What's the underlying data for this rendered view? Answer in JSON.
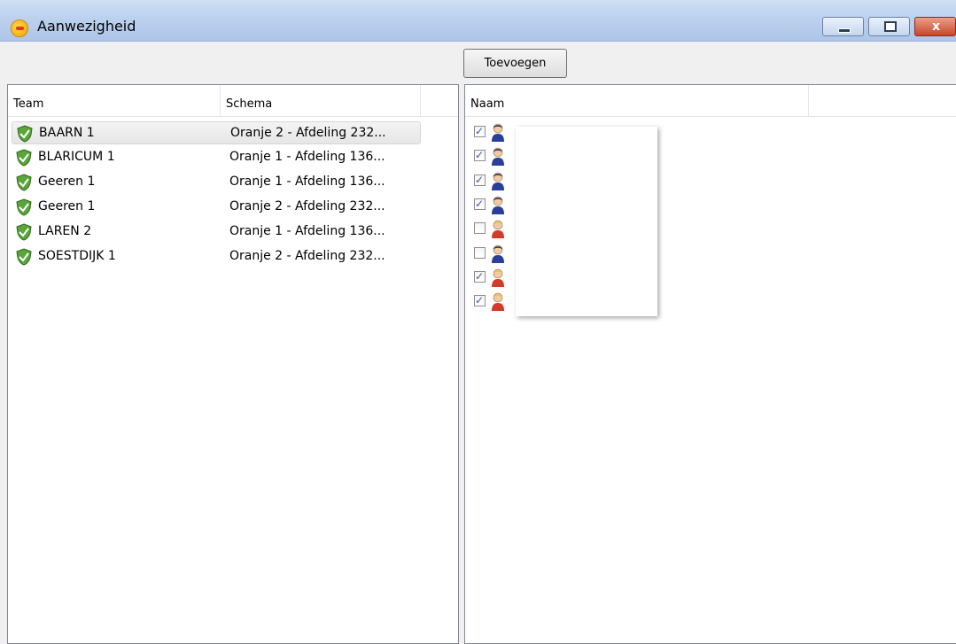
{
  "window": {
    "title": "Aanwezigheid",
    "close_glyph": "x"
  },
  "toolbar": {
    "add_label": "Toevoegen"
  },
  "teams_table": {
    "columns": [
      "Team",
      "Schema"
    ],
    "rows": [
      {
        "team": "BAARN 1",
        "schema": "Oranje 2 - Afdeling 232...",
        "selected": true
      },
      {
        "team": "BLARICUM 1",
        "schema": "Oranje 1 - Afdeling 136...",
        "selected": false
      },
      {
        "team": "Geeren 1",
        "schema": "Oranje 1 - Afdeling 136...",
        "selected": false
      },
      {
        "team": "Geeren 1",
        "schema": "Oranje 2 - Afdeling 232...",
        "selected": false
      },
      {
        "team": "LAREN 2",
        "schema": "Oranje 1 - Afdeling 136...",
        "selected": false
      },
      {
        "team": "SOESTDIJK 1",
        "schema": "Oranje 2 - Afdeling 232...",
        "selected": false
      }
    ]
  },
  "members_table": {
    "columns": [
      "Naam"
    ],
    "members": [
      {
        "checked": true,
        "icon": "male-person-icon"
      },
      {
        "checked": true,
        "icon": "male-person-icon"
      },
      {
        "checked": true,
        "icon": "male-person-icon"
      },
      {
        "checked": true,
        "icon": "male-person-icon"
      },
      {
        "checked": false,
        "icon": "female-person-icon"
      },
      {
        "checked": false,
        "icon": "male-person-icon"
      },
      {
        "checked": true,
        "icon": "female-person-icon"
      },
      {
        "checked": true,
        "icon": "female-person-icon"
      }
    ]
  },
  "colors": {
    "shield_green": "#5aa63a",
    "male_shirt": "#2a3f9a",
    "female_shirt": "#d23b2a",
    "checkmark": "#3a5a9a"
  }
}
